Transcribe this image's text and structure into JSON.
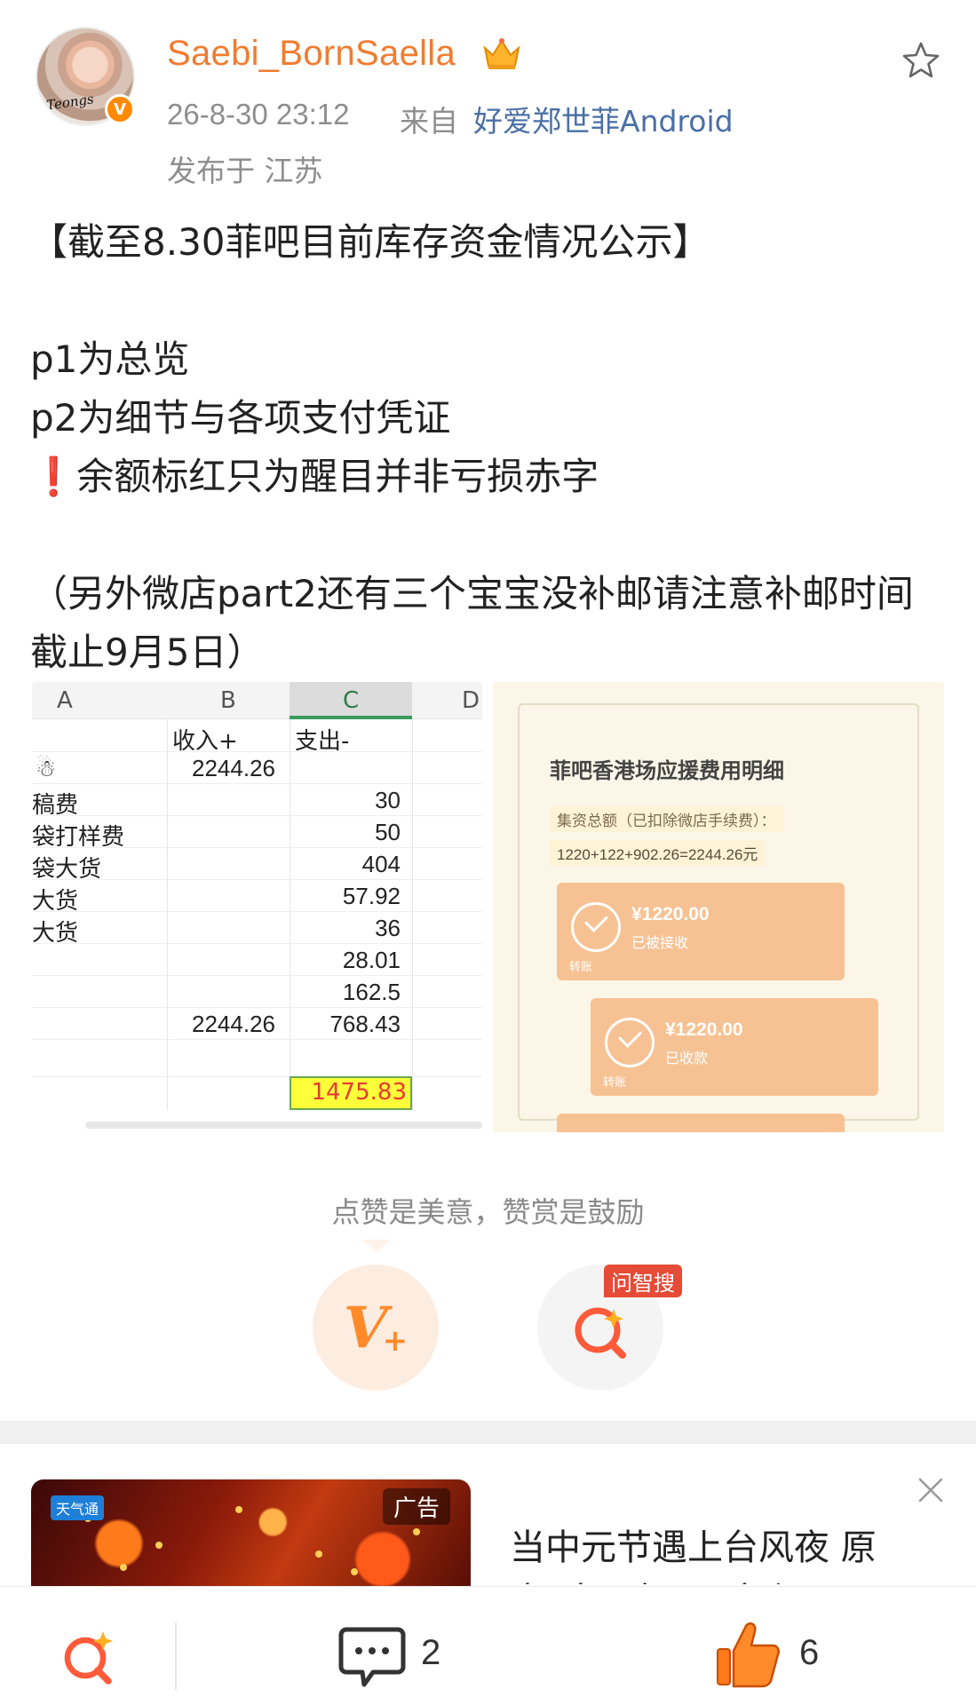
{
  "header": {
    "username": "Saebi_BornSaella",
    "avatar_signature": "Teongs",
    "verified_badge": "V",
    "time": "26-8-30 23:12",
    "from_label": "来自",
    "source": "好爱郑世菲Android",
    "location": "发布于 江苏"
  },
  "post": {
    "lines": [
      "【截至8.30菲吧目前库存资金情况公示】",
      "",
      "p1为总览",
      "p2为细节与各项支付凭证",
      "余额标红只为醒目并非亏损赤字",
      "",
      "（另外微店part2还有三个宝宝没补邮请注意补邮时间",
      "截止9月5日）"
    ],
    "warning_icon": "❗"
  },
  "image1": {
    "columns": [
      "A",
      "B",
      "C",
      "D"
    ],
    "headers": {
      "income": "收入+",
      "expense": "支出-"
    },
    "rows": [
      {
        "label": "",
        "income": "2244.26",
        "expense": ""
      },
      {
        "label": "稿费",
        "income": "",
        "expense": "30"
      },
      {
        "label": "袋打样费",
        "income": "",
        "expense": "50"
      },
      {
        "label": "袋大货",
        "income": "",
        "expense": "404"
      },
      {
        "label": "大货",
        "income": "",
        "expense": "57.92"
      },
      {
        "label": "大货",
        "income": "",
        "expense": "36"
      },
      {
        "label": "",
        "income": "",
        "expense": "28.01"
      },
      {
        "label": "",
        "income": "",
        "expense": "162.5"
      },
      {
        "label": "",
        "income": "2244.26",
        "expense": "768.43"
      }
    ],
    "balance": "1475.83"
  },
  "image2": {
    "title": "菲吧香港场应援费用明细",
    "subtitle": "集资总额（已扣除微店手续费）：",
    "formula": "1220+122+902.26=2244.26元",
    "cards": [
      {
        "amount": "¥1220.00",
        "status": "已被接收",
        "note": "转账"
      },
      {
        "amount": "¥1220.00",
        "status": "已收款",
        "note": "转账"
      }
    ]
  },
  "reward": {
    "text": "点赞是美意，赞赏是鼓励",
    "wzs_label": "问智搜"
  },
  "ad": {
    "logo": "天气通",
    "badge": "广告",
    "title_line1": "当中元节遇上台风夜 原",
    "title_line2": "来“鬼天气”是这个原?"
  },
  "bottombar": {
    "comment_count": "2",
    "like_count": "6"
  },
  "colors": {
    "username": "#f07c30",
    "source_link": "#4a6fa5",
    "accent_orange": "#ff8a2a",
    "balance_red": "#e53935",
    "balance_yellow": "#ffff3a"
  }
}
